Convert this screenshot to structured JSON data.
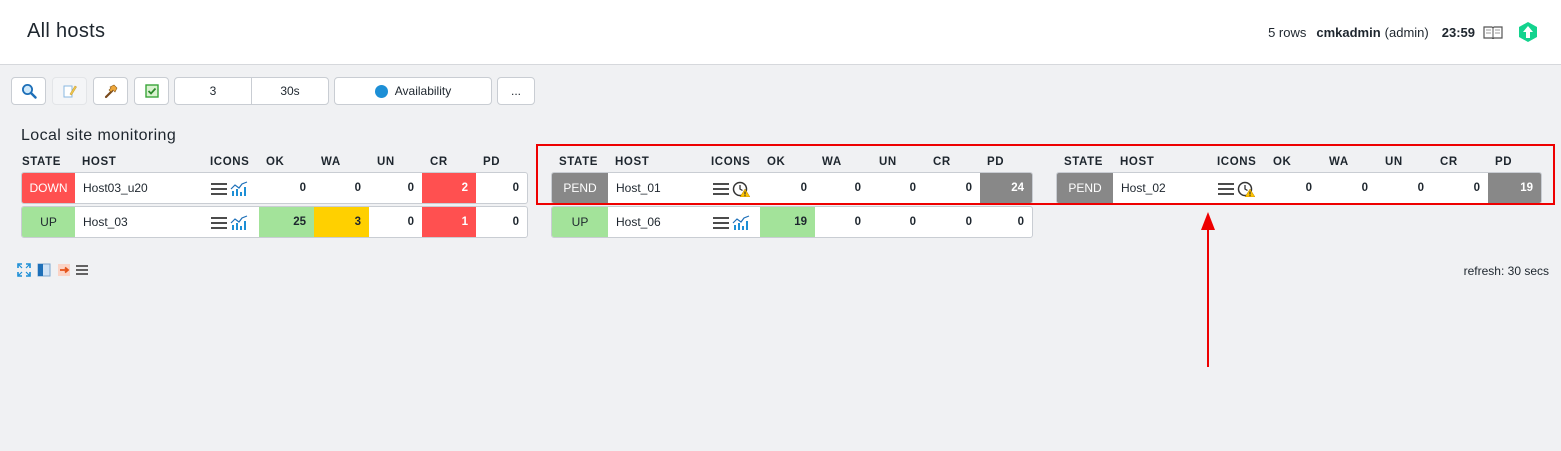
{
  "header": {
    "title": "All hosts",
    "rows": "5 rows",
    "user": "cmkadmin",
    "role": "(admin)",
    "clock": "23:59"
  },
  "toolbar": {
    "search_icon": "search-icon",
    "edit_icon": "edit-icon",
    "commands_icon": "hammer-icon",
    "checkbox_icon": "checkbox-icon",
    "columns_value": "3",
    "refresh_value": "30s",
    "availability_label": "Availability",
    "more_label": "..."
  },
  "section": {
    "title": "Local site monitoring"
  },
  "columns": {
    "state": "STATE",
    "host": "HOST",
    "icons": "ICONS",
    "ok": "OK",
    "wa": "WA",
    "un": "UN",
    "cr": "CR",
    "pd": "PD"
  },
  "hosts": [
    {
      "state": "DOWN",
      "host": "Host03_u20",
      "icons": [
        "menu-icon",
        "graph-icon"
      ],
      "ok": "0",
      "wa": "0",
      "un": "0",
      "cr": "2",
      "pd": "0"
    },
    {
      "state": "UP",
      "host": "Host_03",
      "icons": [
        "menu-icon",
        "graph-icon"
      ],
      "ok": "25",
      "wa": "3",
      "un": "0",
      "cr": "1",
      "pd": "0"
    },
    {
      "state": "PEND",
      "host": "Host_01",
      "icons": [
        "menu-icon",
        "pending-clock-icon"
      ],
      "ok": "0",
      "wa": "0",
      "un": "0",
      "cr": "0",
      "pd": "24"
    },
    {
      "state": "UP",
      "host": "Host_06",
      "icons": [
        "menu-icon",
        "graph-icon"
      ],
      "ok": "19",
      "wa": "0",
      "un": "0",
      "cr": "0",
      "pd": "0"
    },
    {
      "state": "PEND",
      "host": "Host_02",
      "icons": [
        "menu-icon",
        "pending-clock-icon"
      ],
      "ok": "0",
      "wa": "0",
      "un": "0",
      "cr": "0",
      "pd": "19"
    }
  ],
  "colors": {
    "down": "#ff5050",
    "up": "#a3e39a",
    "pend": "#888888",
    "warn": "#ffd000",
    "highlight": "#ee0000",
    "logo": "#13d38e"
  },
  "footer": {
    "icons": [
      "fullscreen-icon",
      "sidebar-toggle-icon",
      "export-icon",
      "list-icon"
    ],
    "refresh": "refresh: 30 secs"
  }
}
